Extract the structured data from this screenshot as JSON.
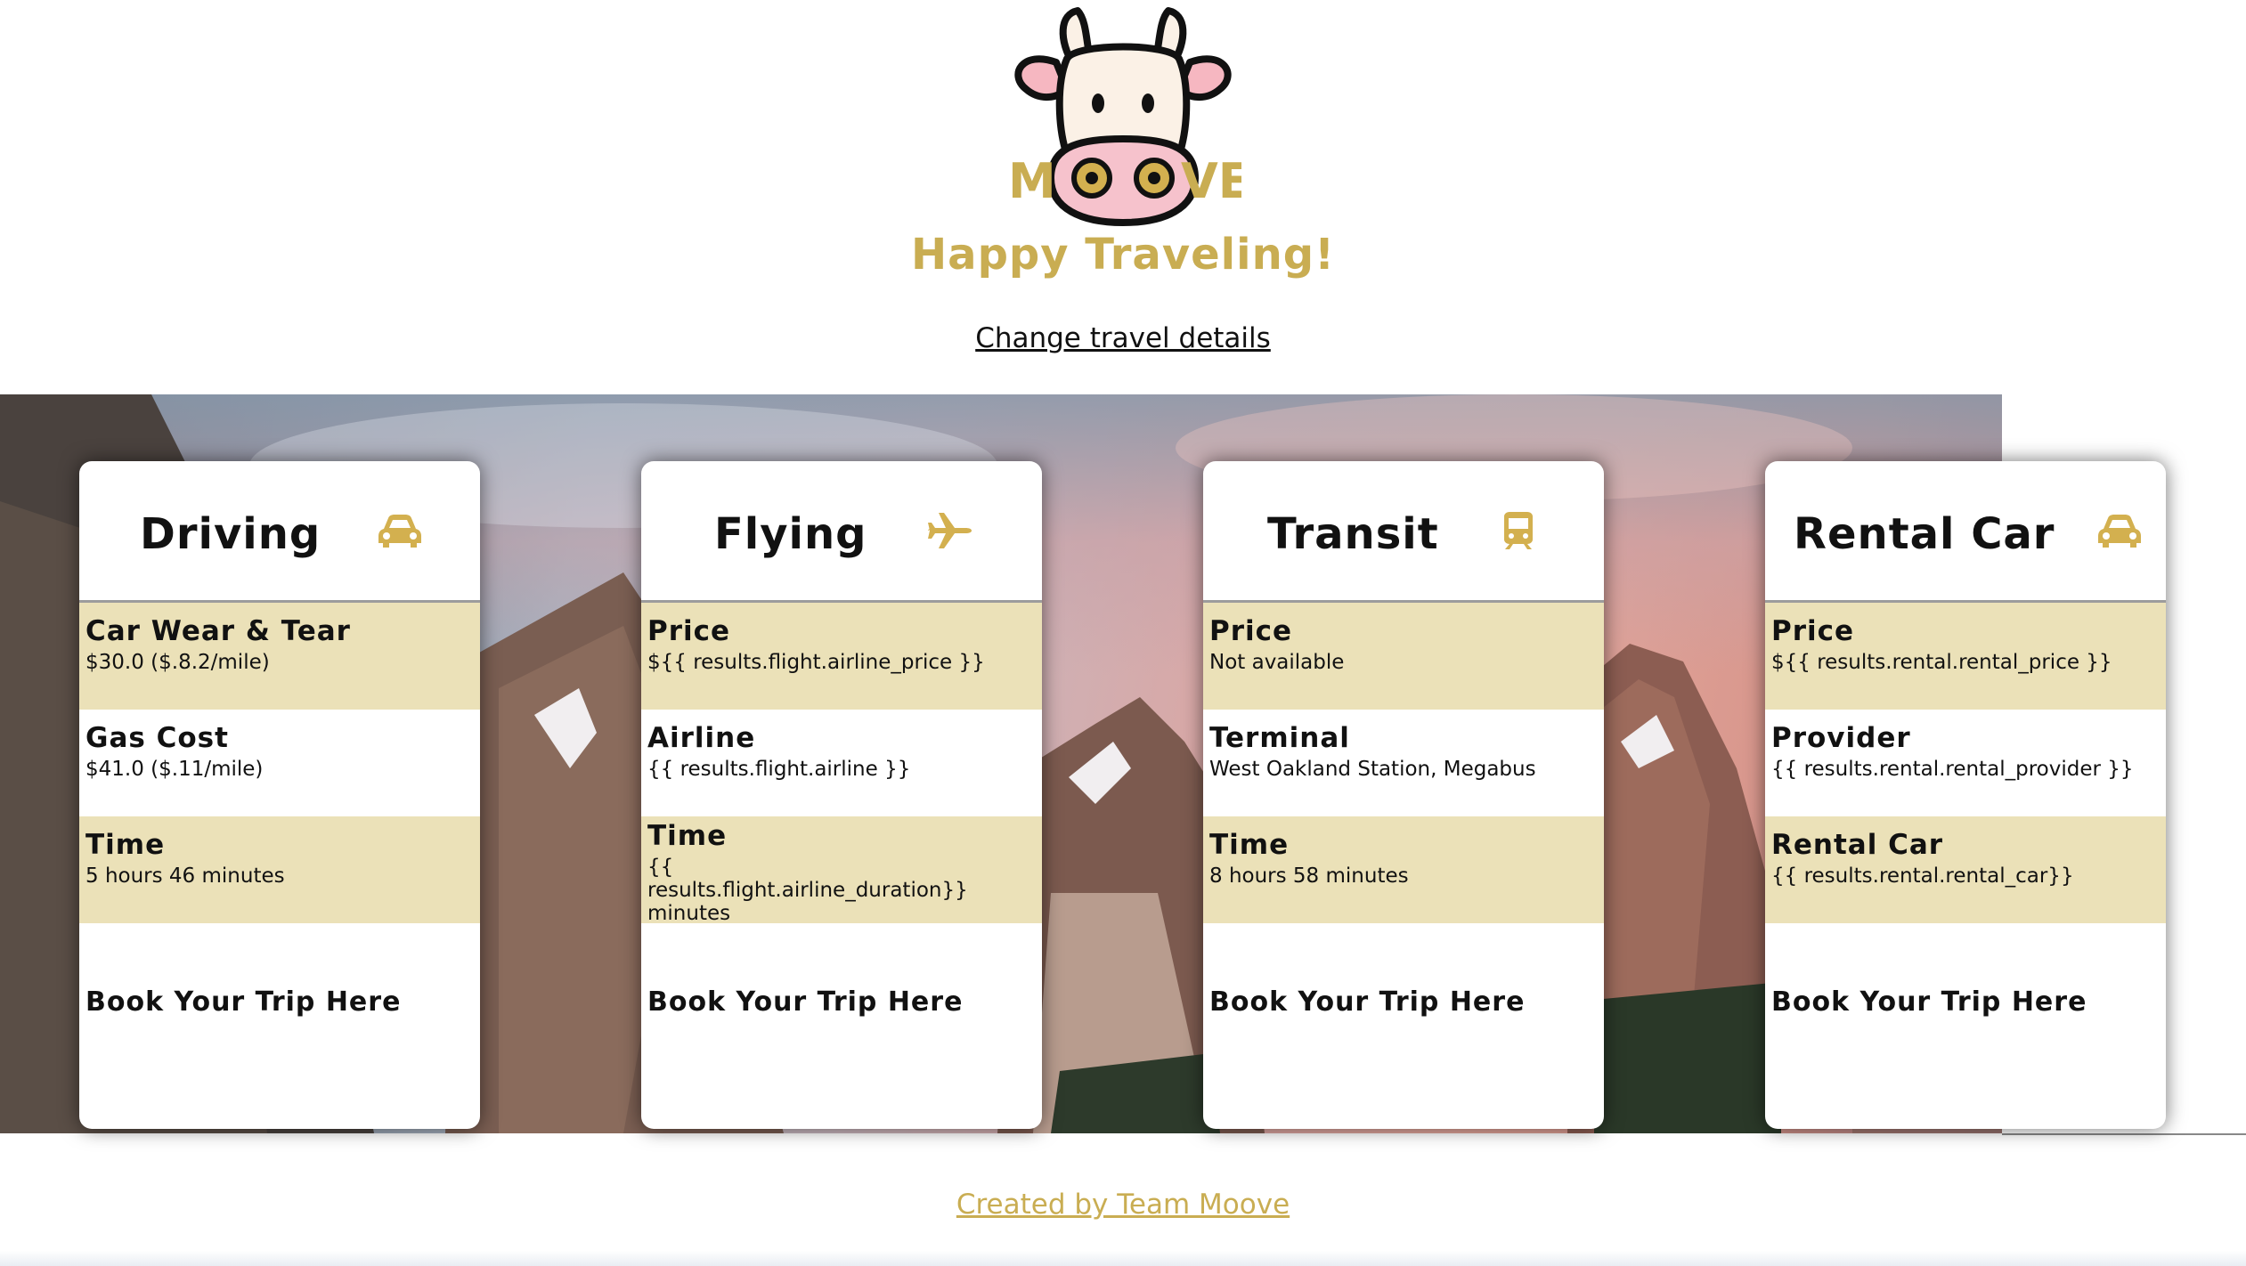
{
  "brand": {
    "logo_text": "MOOVE",
    "accent": "#c9ad52"
  },
  "header": {
    "tagline": "Happy Traveling!",
    "change_link": "Change travel details"
  },
  "cards": [
    {
      "title": "Driving",
      "icon": "car-icon",
      "rows": [
        {
          "label": "Car Wear & Tear",
          "value": "$30.0 ($.8.2/mile)"
        },
        {
          "label": "Gas Cost",
          "value": "$41.0 ($.11/mile)"
        },
        {
          "label": "Time",
          "value": "5 hours 46 minutes"
        }
      ],
      "book": "Book Your Trip Here"
    },
    {
      "title": "Flying",
      "icon": "plane-icon",
      "rows": [
        {
          "label": "Price",
          "value": "${{ results.flight.airline_price }}"
        },
        {
          "label": "Airline",
          "value": "{{ results.flight.airline }}"
        },
        {
          "label": "Time",
          "value": "{{ results.flight.airline_duration}} minutes"
        }
      ],
      "book": "Book Your Trip Here"
    },
    {
      "title": "Transit",
      "icon": "train-icon",
      "rows": [
        {
          "label": "Price",
          "value": "Not available"
        },
        {
          "label": "Terminal",
          "value": "West Oakland Station, Megabus"
        },
        {
          "label": "Time",
          "value": "8 hours 58 minutes"
        }
      ],
      "book": "Book Your Trip Here"
    },
    {
      "title": "Rental Car",
      "icon": "car-icon",
      "rows": [
        {
          "label": "Price",
          "value": "${{ results.rental.rental_price }}"
        },
        {
          "label": "Provider",
          "value": "{{ results.rental.rental_provider }}"
        },
        {
          "label": "Rental Car",
          "value": "{{ results.rental.rental_car}}"
        }
      ],
      "book": "Book Your Trip Here"
    }
  ],
  "footer": {
    "link": "Created by Team Moove"
  }
}
